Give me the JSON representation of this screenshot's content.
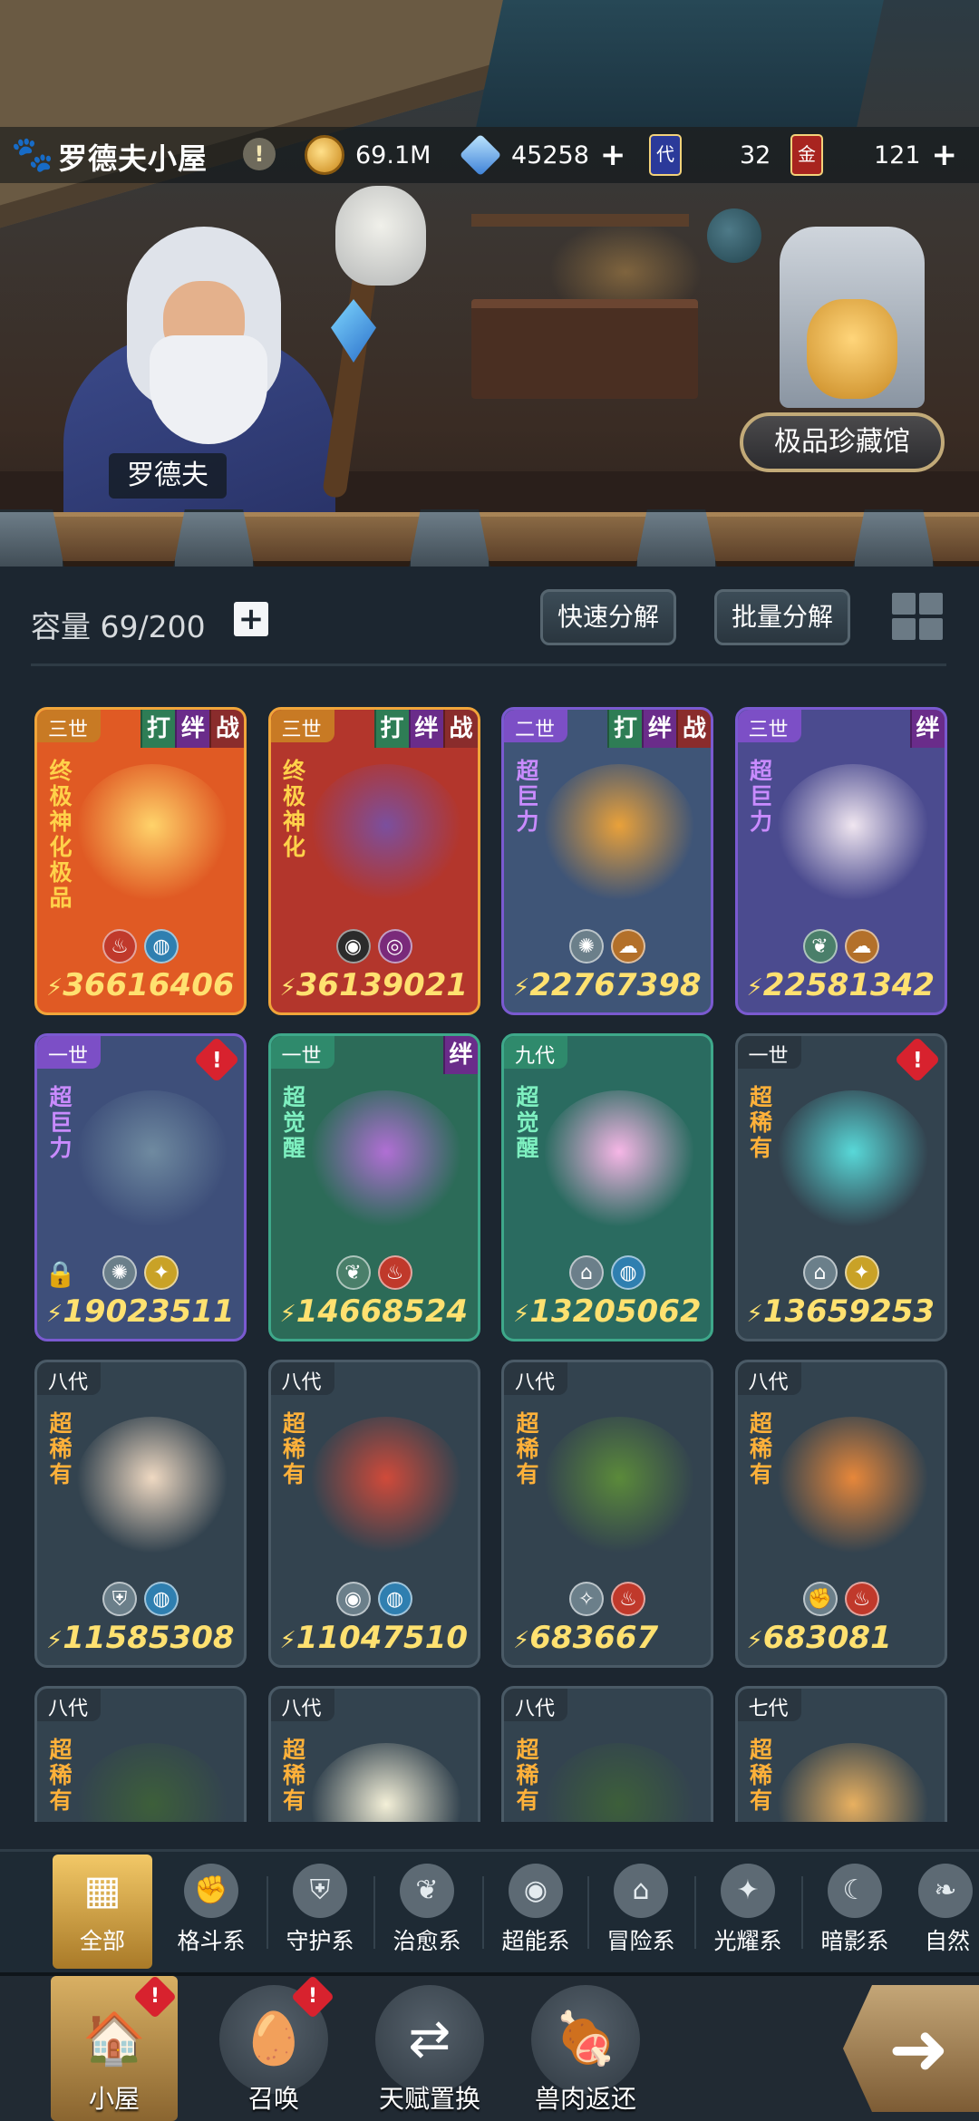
{
  "header": {
    "title": "罗德夫小屋",
    "resources": {
      "coins": "69.1M",
      "gems": "45258",
      "dai_cards": "32",
      "jin_cards": "121",
      "dai_card_label": "代",
      "jin_card_label": "金"
    }
  },
  "scene": {
    "npc_name": "罗德夫",
    "museum_button": "极品珍藏馆"
  },
  "panel": {
    "capacity": "容量 69/200",
    "quick_decompose": "快速分解",
    "batch_decompose": "批量分解"
  },
  "tag_labels": {
    "fight": "打",
    "bond": "绊",
    "battle": "战"
  },
  "cards": [
    {
      "generation": "三世",
      "rarity": "终极神化极品",
      "power": "36616406",
      "tags": [
        "打",
        "绊",
        "战"
      ],
      "theme": "#e05a24"
    },
    {
      "generation": "三世",
      "rarity": "终极神化",
      "power": "36139021",
      "tags": [
        "打",
        "绊",
        "战"
      ],
      "theme": "#b3362c"
    },
    {
      "generation": "二世",
      "rarity": "超巨力",
      "power": "22767398",
      "tags": [
        "打",
        "绊",
        "战"
      ],
      "theme": "#3f5577"
    },
    {
      "generation": "三世",
      "rarity": "超巨力",
      "power": "22581342",
      "tags": [
        "绊"
      ],
      "theme": "#4b4b8f"
    },
    {
      "generation": "一世",
      "rarity": "超巨力",
      "power": "19023511",
      "tags": [],
      "theme": "#3e4f7a"
    },
    {
      "generation": "一世",
      "rarity": "超觉醒",
      "power": "14668524",
      "tags": [
        "绊"
      ],
      "theme": "#2c6b58"
    },
    {
      "generation": "九代",
      "rarity": "超觉醒",
      "power": "13205062",
      "tags": [],
      "theme": "#2a6b60"
    },
    {
      "generation": "一世",
      "rarity": "超稀有",
      "power": "13659253",
      "tags": [],
      "theme": "#33434f"
    },
    {
      "generation": "八代",
      "rarity": "超稀有",
      "power": "11585308",
      "tags": [],
      "theme": "#33434f"
    },
    {
      "generation": "八代",
      "rarity": "超稀有",
      "power": "11047510",
      "tags": [],
      "theme": "#33434f"
    },
    {
      "generation": "八代",
      "rarity": "超稀有",
      "power": "683667",
      "tags": [],
      "theme": "#33434f"
    },
    {
      "generation": "八代",
      "rarity": "超稀有",
      "power": "683081",
      "tags": [],
      "theme": "#33434f"
    },
    {
      "generation": "八代",
      "rarity": "超稀有",
      "power": "",
      "tags": [],
      "theme": "#33434f"
    },
    {
      "generation": "八代",
      "rarity": "超稀有",
      "power": "",
      "tags": [],
      "theme": "#33434f"
    },
    {
      "generation": "八代",
      "rarity": "超稀有",
      "power": "",
      "tags": [],
      "theme": "#33434f"
    },
    {
      "generation": "七代",
      "rarity": "超稀有",
      "power": "",
      "tags": [],
      "theme": "#33434f"
    }
  ],
  "categories": [
    "全部",
    "格斗系",
    "守护系",
    "治愈系",
    "超能系",
    "冒险系",
    "光耀系",
    "暗影系",
    "自然"
  ],
  "nav": [
    "小屋",
    "召唤",
    "天赋置换",
    "兽肉返还"
  ],
  "colors": {
    "accent_gold": "#f2c867",
    "alert_red": "#d8222e",
    "power_yellow": "#ffe170"
  }
}
